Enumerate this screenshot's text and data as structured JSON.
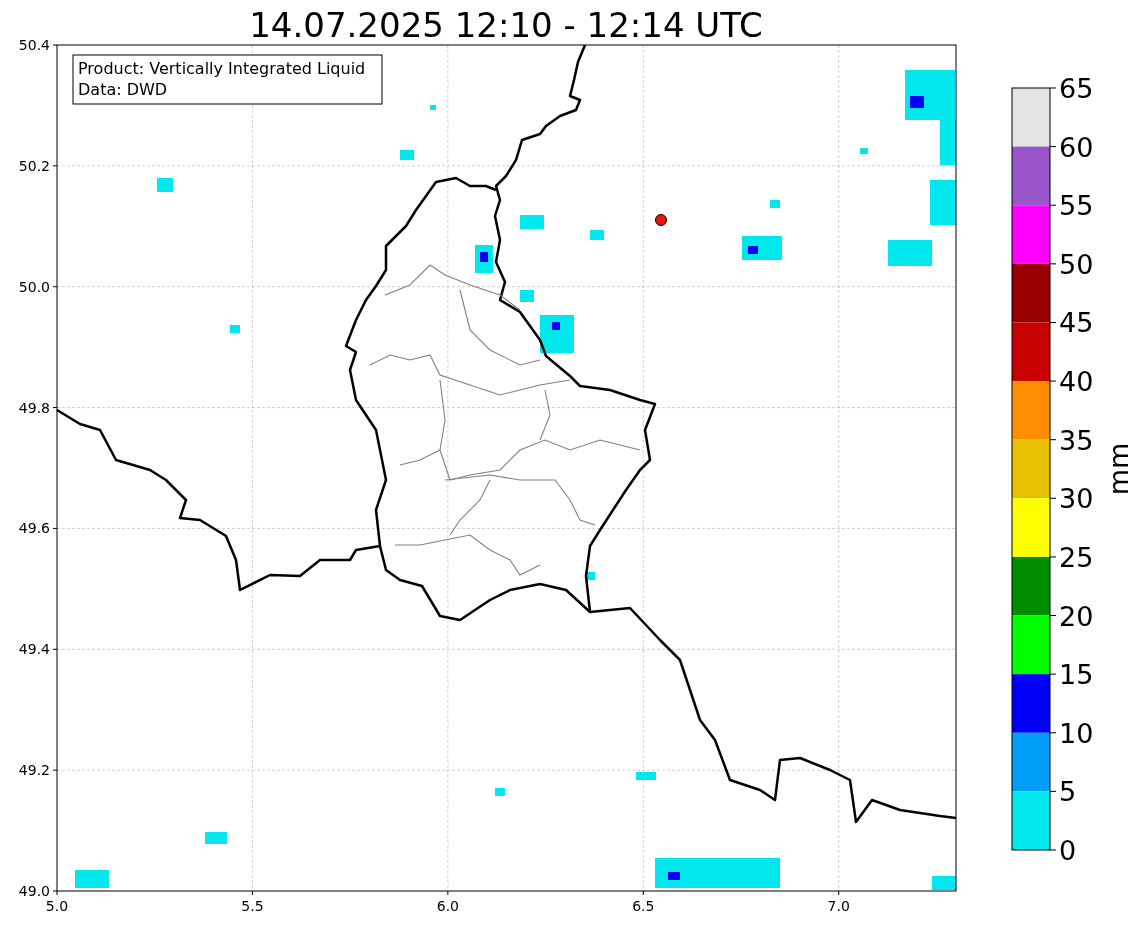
{
  "title": "14.07.2025 12:10 - 12:14 UTC",
  "map": {
    "legend": [
      "Product: Vertically Integrated Liquid",
      "Data: DWD"
    ],
    "x_ticks": [
      "5.0",
      "5.5",
      "6.0",
      "6.5",
      "7.0"
    ],
    "y_ticks": [
      "50.4",
      "50.2",
      "50.0",
      "49.8",
      "49.6",
      "49.4",
      "49.2",
      "49.0"
    ]
  },
  "colorbar": {
    "label": "mm",
    "ticks": [
      "65",
      "60",
      "55",
      "50",
      "45",
      "40",
      "35",
      "30",
      "25",
      "20",
      "15",
      "10",
      "5",
      "0"
    ],
    "bins": [
      {
        "color": "#e3e3e3"
      },
      {
        "color": "#9955c9"
      },
      {
        "color": "#ff00ff"
      },
      {
        "color": "#9a0000"
      },
      {
        "color": "#c80000"
      },
      {
        "color": "#ff8e00"
      },
      {
        "color": "#e7c000"
      },
      {
        "color": "#ffff00"
      },
      {
        "color": "#008e00"
      },
      {
        "color": "#00ff00"
      },
      {
        "color": "#0000f6"
      },
      {
        "color": "#009ef7"
      },
      {
        "color": "#00e8ee"
      }
    ]
  }
}
